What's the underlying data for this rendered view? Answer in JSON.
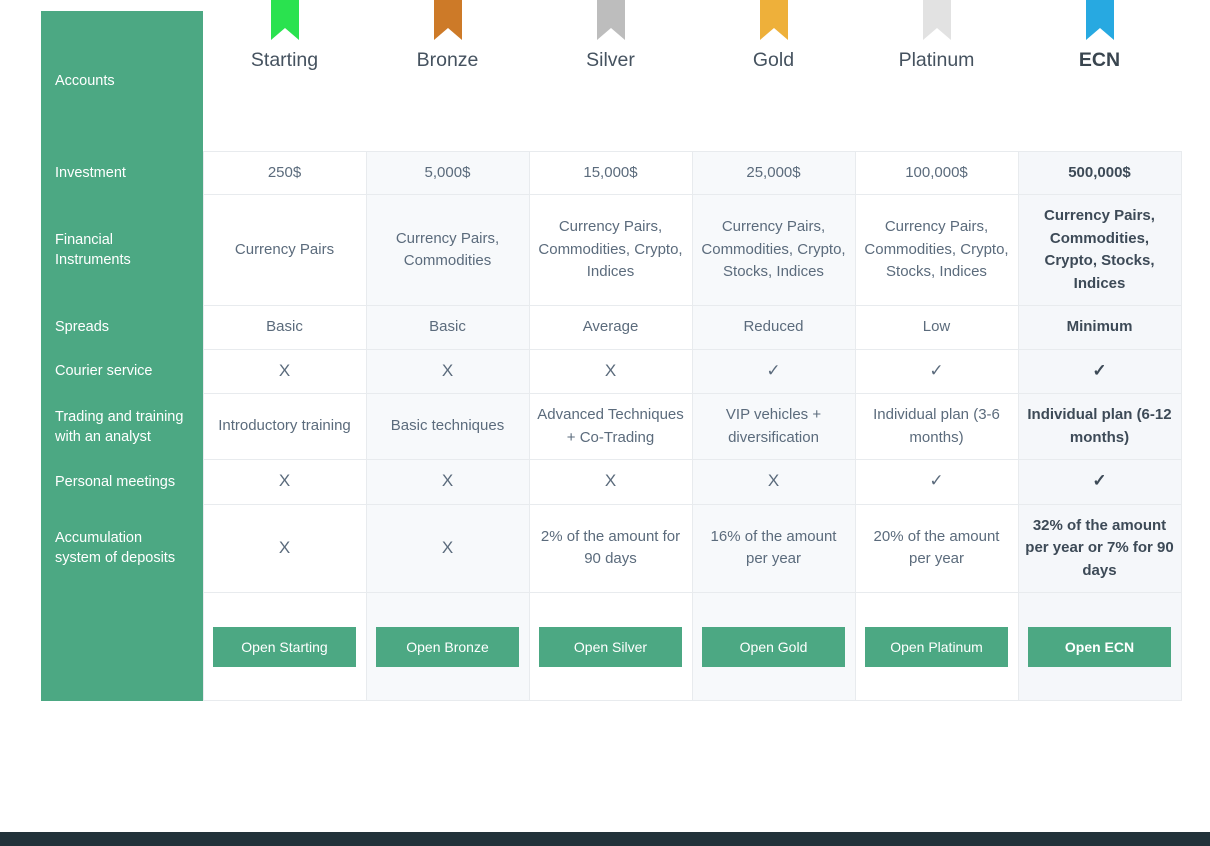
{
  "table": {
    "sidebar_label_accounts": "Accounts",
    "row_labels": [
      "Investment",
      "Financial Instruments",
      "Spreads",
      "Courier service",
      "Trading and training with an analyst",
      "Personal meetings",
      "Accumulation system of deposits"
    ],
    "plans": [
      {
        "name": "Starting",
        "bookmark_icon": "bookmark-icon",
        "bookmark_color": "#2ae24f",
        "featured": false,
        "cta": "Open Starting"
      },
      {
        "name": "Bronze",
        "bookmark_icon": "bookmark-icon",
        "bookmark_color": "#cd7a28",
        "featured": false,
        "cta": "Open Bronze"
      },
      {
        "name": "Silver",
        "bookmark_icon": "bookmark-icon",
        "bookmark_color": "#bdbdbd",
        "featured": false,
        "cta": "Open Silver"
      },
      {
        "name": "Gold",
        "bookmark_icon": "bookmark-icon",
        "bookmark_color": "#eeb03a",
        "featured": false,
        "cta": "Open Gold"
      },
      {
        "name": "Platinum",
        "bookmark_icon": "bookmark-icon",
        "bookmark_color": "#e2e2e2",
        "featured": false,
        "cta": "Open Platinum"
      },
      {
        "name": "ECN",
        "bookmark_icon": "bookmark-icon",
        "bookmark_color": "#27a9e1",
        "featured": true,
        "cta": "Open ECN"
      }
    ],
    "rows": [
      {
        "label": "Investment",
        "values": [
          "250$",
          "5,000$",
          "15,000$",
          "25,000$",
          "100,000$",
          "500,000$"
        ]
      },
      {
        "label": "Financial Instruments",
        "values": [
          "Currency Pairs",
          "Currency Pairs, Commodities",
          "Currency Pairs, Commodities, Crypto, Indices",
          "Currency Pairs, Commodities, Crypto, Stocks, Indices",
          "Currency Pairs, Commodities, Crypto, Stocks, Indices",
          "Currency Pairs, Commodities, Crypto, Stocks, Indices"
        ]
      },
      {
        "label": "Spreads",
        "values": [
          "Basic",
          "Basic",
          "Average",
          "Reduced",
          "Low",
          "Minimum"
        ]
      },
      {
        "label": "Courier service",
        "values": [
          "X",
          "X",
          "X",
          "✓",
          "✓",
          "✓"
        ]
      },
      {
        "label": "Trading and training with an analyst",
        "values": [
          "Introductory training",
          "Basic techniques",
          "Advanced Techniques + Co-Trading",
          "VIP vehicles + diversification",
          "Individual plan (3-6 months)",
          "Individual plan (6-12 months)"
        ]
      },
      {
        "label": "Personal meetings",
        "values": [
          "X",
          "X",
          "X",
          "X",
          "✓",
          "✓"
        ]
      },
      {
        "label": "Accumulation system of deposits",
        "values": [
          "X",
          "X",
          "2% of the amount for 90 days",
          "16% of the amount per year",
          "20% of the amount per year",
          "32% of the amount per year or 7% for 90 days"
        ]
      }
    ],
    "colors": {
      "sidebar_green": "#4ca883",
      "button_green": "#4ca883",
      "cell_border": "#e8ebee",
      "shade_background": "#f7f9fb",
      "feature_background": "#f5f7fa",
      "text": "#5b6b7c",
      "footer_strip": "#22323a"
    }
  }
}
